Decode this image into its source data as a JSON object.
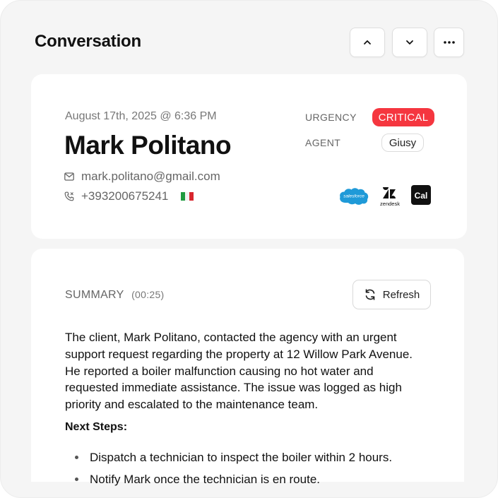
{
  "header": {
    "title": "Conversation",
    "buttons": [
      {
        "icon": "chevron-up-icon"
      },
      {
        "icon": "chevron-down-icon"
      },
      {
        "icon": "more-horizontal-icon"
      }
    ]
  },
  "contact": {
    "datetime": "August 17th, 2025 @ 6:36 PM",
    "name": "Mark Politano",
    "email": "mark.politano@gmail.com",
    "phone": "+393200675241",
    "flag_icon": "italy-flag-icon",
    "urgency_label": "URGENCY",
    "urgency_value": "CRITICAL",
    "agent_label": "AGENT",
    "agent_value": "Giusy",
    "integrations": [
      {
        "name": "salesforce",
        "icon": "salesforce-logo-icon"
      },
      {
        "name": "zendesk",
        "icon": "zendesk-logo-icon"
      },
      {
        "name": "Cal",
        "icon": "cal-logo-icon"
      }
    ]
  },
  "summary": {
    "label": "SUMMARY",
    "duration": "(00:25)",
    "refresh_label": "Refresh",
    "text": "The client, Mark Politano, contacted the agency with an urgent support request regarding the property at 12 Willow Park Avenue. He reported a boiler malfunction causing no hot water and requested immediate assistance. The issue was logged as high priority and escalated to the maintenance team.",
    "next_steps_heading": "Next Steps:",
    "steps": [
      "Dispatch a technician to inspect the boiler within 2 hours.",
      "Notify Mark once the technician is en route."
    ]
  },
  "colors": {
    "critical": "#f5363f",
    "background": "#f5f5f5",
    "card": "#ffffff"
  }
}
